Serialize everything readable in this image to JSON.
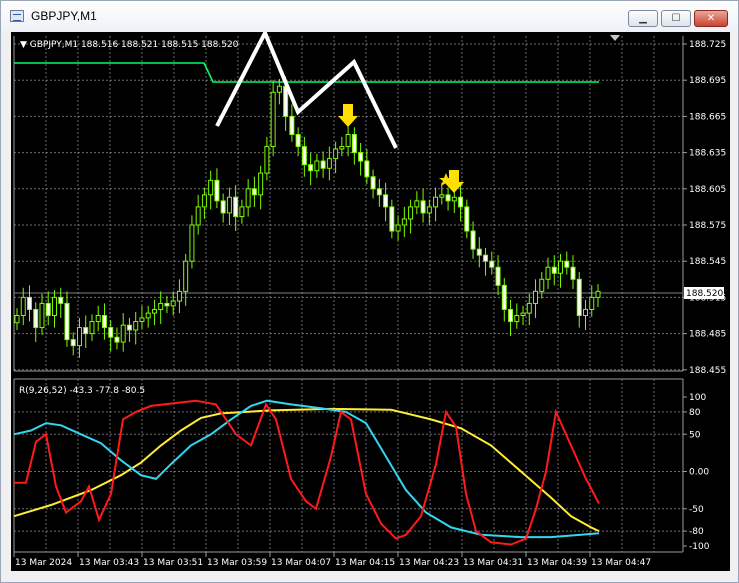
{
  "window": {
    "title": "GBPJPY,M1",
    "buttons": {
      "minimize": "▁",
      "maximize": "☐",
      "close": "✕"
    }
  },
  "main_chart": {
    "header": "▼ GBPJPY,M1  188.516 188.521 188.515 188.520",
    "price_ticks": [
      "188.725",
      "188.695",
      "188.665",
      "188.635",
      "188.605",
      "188.575",
      "188.545",
      "188.515",
      "188.485",
      "188.455"
    ],
    "current_price": "188.520",
    "colors": {
      "bull": "#7cfc00",
      "bear": "#7cfc00",
      "bull_body": "#000000",
      "bear_body": "#ffffff",
      "grid": "#707070",
      "level_line": "#00ff66",
      "zigzag": "#ffffff",
      "arrow": "#ffe000"
    }
  },
  "indicator": {
    "header": "R(9,26,52) -43.3 -77.8 -80.5",
    "ticks": [
      "100",
      "80",
      "50",
      "0.00",
      "-50",
      "-80",
      "-100"
    ],
    "colors": {
      "fast": "#ff1a1a",
      "mid": "#33d6f0",
      "slow": "#ffee33"
    }
  },
  "time_axis": [
    "13 Mar 2024",
    "13 Mar 03:43",
    "13 Mar 03:51",
    "13 Mar 03:59",
    "13 Mar 04:07",
    "13 Mar 04:15",
    "13 Mar 04:23",
    "13 Mar 04:31",
    "13 Mar 04:39",
    "13 Mar 04:47"
  ]
}
